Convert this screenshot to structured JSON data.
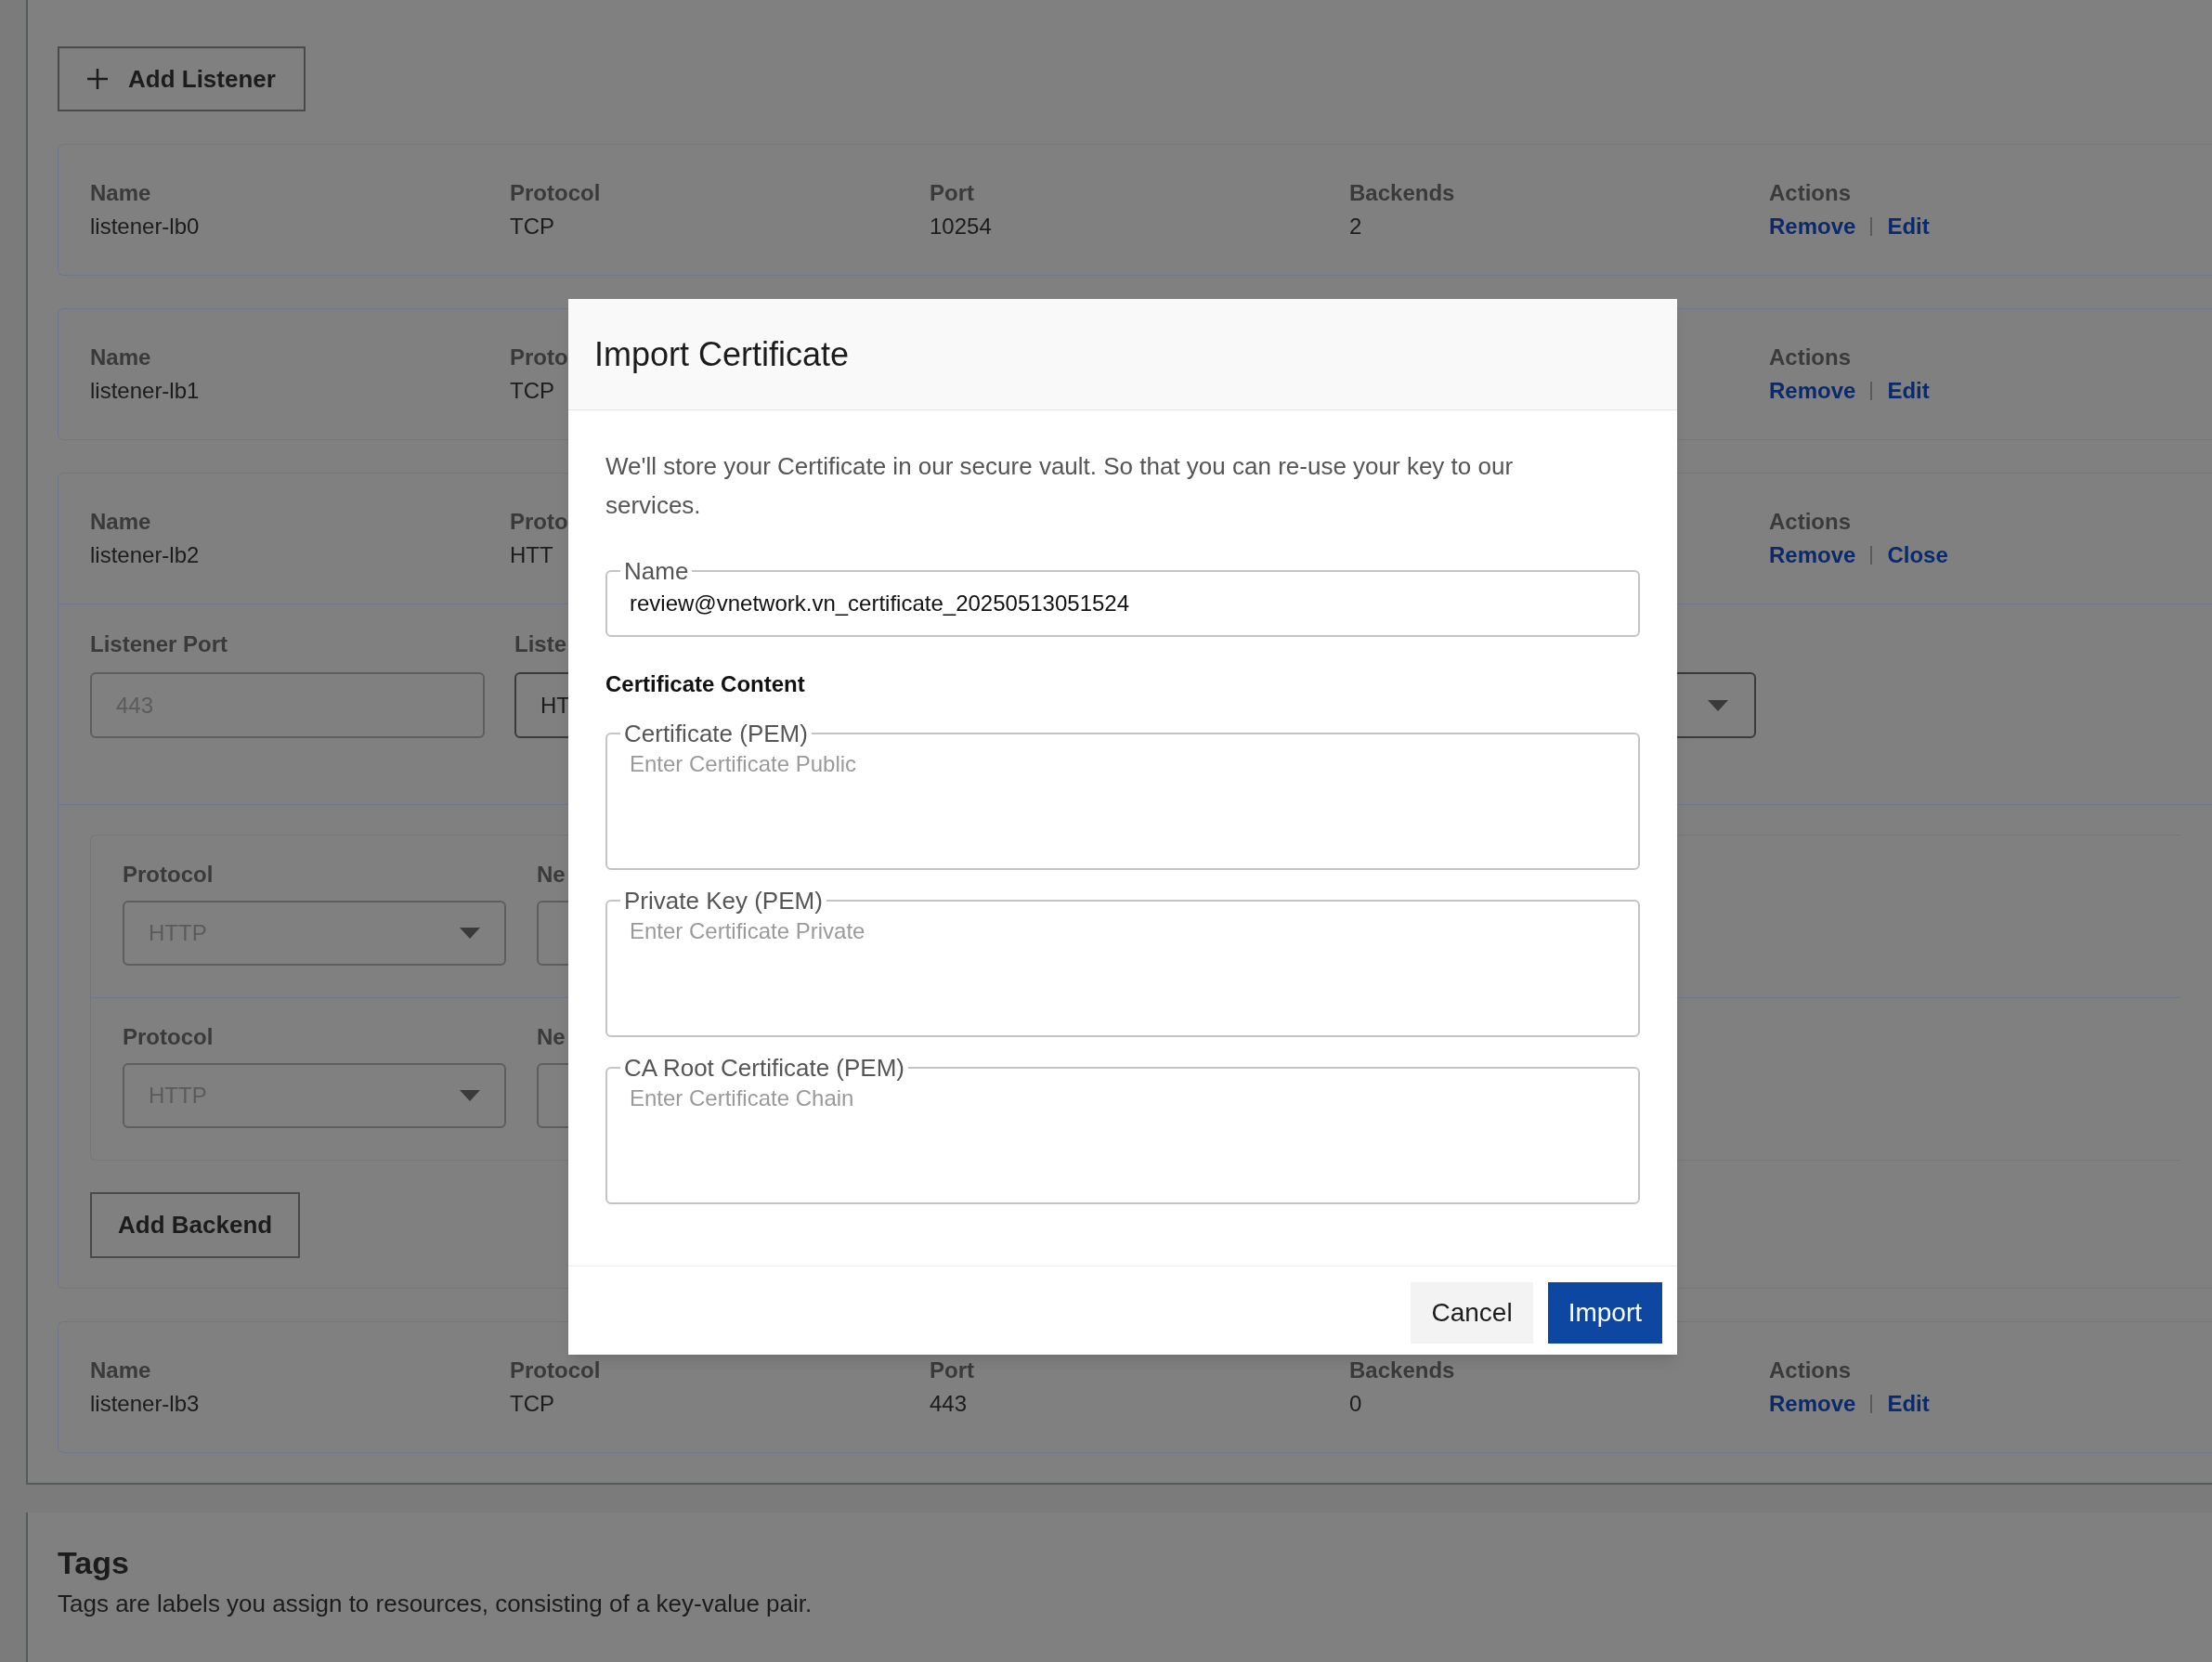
{
  "add_listener_button": "Add Listener",
  "listeners": [
    {
      "columns": [
        {
          "label": "Name",
          "value": "listener-lb0"
        },
        {
          "label": "Protocol",
          "value": "TCP"
        },
        {
          "label": "Port",
          "value": "10254"
        },
        {
          "label": "Backends",
          "value": "2"
        }
      ],
      "actions_label": "Actions",
      "actions": [
        "Remove",
        "Edit"
      ]
    },
    {
      "columns": [
        {
          "label": "Name",
          "value": "listener-lb1"
        },
        {
          "label": "Proto",
          "value": "TCP"
        }
      ],
      "actions_label": "Actions",
      "actions": [
        "Remove",
        "Edit"
      ]
    },
    {
      "columns": [
        {
          "label": "Name",
          "value": "listener-lb2"
        },
        {
          "label": "Proto",
          "value": "HTT"
        }
      ],
      "actions_label": "Actions",
      "actions": [
        "Remove",
        "Close"
      ],
      "details": {
        "port_label": "Listener Port",
        "port": {
          "value": "443",
          "disabled": true
        },
        "protocol_label": "Liste",
        "protocol": {
          "value": "HT",
          "disabled": false
        },
        "backends": [
          {
            "protocol_label": "Protocol",
            "protocol": {
              "value": "HTTP",
              "disabled": true
            },
            "next_label": "Ne"
          },
          {
            "protocol_label": "Protocol",
            "protocol": {
              "value": "HTTP",
              "disabled": true
            },
            "next_label": "Ne"
          }
        ],
        "add_backend_button": "Add Backend"
      }
    },
    {
      "columns": [
        {
          "label": "Name",
          "value": "listener-lb3"
        },
        {
          "label": "Protocol",
          "value": "TCP"
        },
        {
          "label": "Port",
          "value": "443"
        },
        {
          "label": "Backends",
          "value": "0"
        }
      ],
      "actions_label": "Actions",
      "actions": [
        "Remove",
        "Edit"
      ]
    }
  ],
  "tags": {
    "title": "Tags",
    "description": "Tags are labels you assign to resources, consisting of a key-value pair."
  },
  "dialog": {
    "title": "Import Certificate",
    "description": "We'll store your Certificate in our secure vault. So that you can re-use your key to our services.",
    "name_field": {
      "label": "Name",
      "value": "review@vnetwork.vn_certificate_20250513051524"
    },
    "section_title": "Certificate Content",
    "text_fields": [
      {
        "label": "Certificate (PEM)",
        "placeholder": "Enter Certificate Public"
      },
      {
        "label": "Private Key (PEM)",
        "placeholder": "Enter Certificate Private"
      },
      {
        "label": "CA Root Certificate (PEM)",
        "placeholder": "Enter Certificate Chain"
      }
    ],
    "buttons": [
      {
        "label": "Cancel",
        "kind": "secondary"
      },
      {
        "label": "Import",
        "kind": "primary"
      }
    ]
  }
}
